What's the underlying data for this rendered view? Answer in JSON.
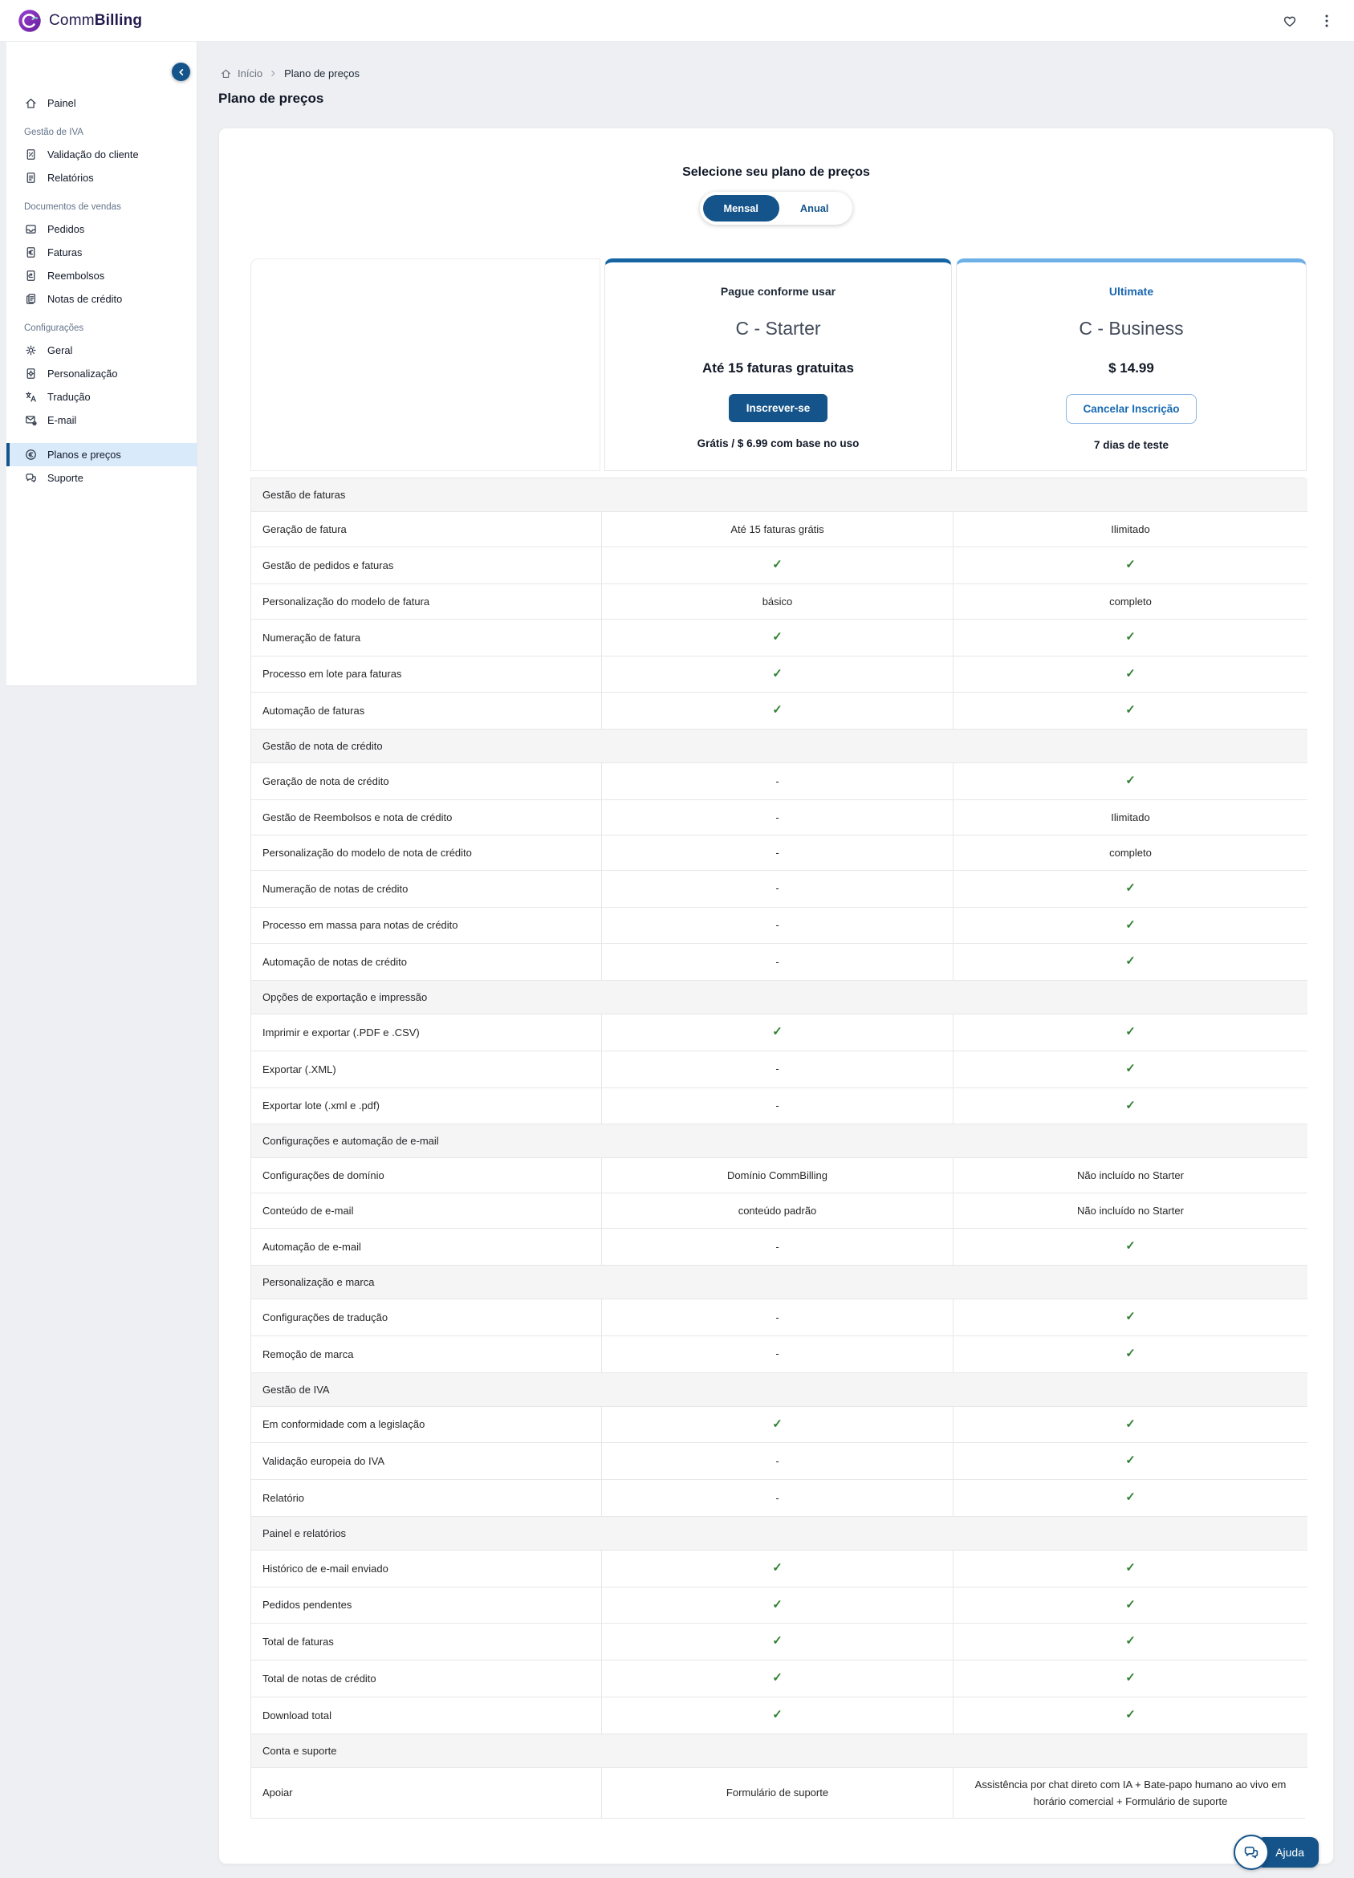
{
  "header": {
    "brand_prefix": "Comm",
    "brand_suffix": "Billing"
  },
  "breadcrumb": {
    "home": "Início",
    "current": "Plano de preços"
  },
  "page_title": "Plano de preços",
  "sidebar": {
    "groups": [
      {
        "label": null,
        "items": [
          {
            "icon": "home",
            "label": "Painel"
          }
        ]
      },
      {
        "label": "Gestão de IVA",
        "items": [
          {
            "icon": "receipt-percent",
            "label": "Validação do cliente"
          },
          {
            "icon": "doc",
            "label": "Relatórios"
          }
        ]
      },
      {
        "label": "Documentos de vendas",
        "items": [
          {
            "icon": "inbox",
            "label": "Pedidos"
          },
          {
            "icon": "receipt-euro",
            "label": "Faturas"
          },
          {
            "icon": "receipt-return",
            "label": "Reembolsos"
          },
          {
            "icon": "copy-doc",
            "label": "Notas de crédito"
          }
        ]
      },
      {
        "label": "Configurações",
        "items": [
          {
            "icon": "gear",
            "label": "Geral"
          },
          {
            "icon": "doc-gear",
            "label": "Personalização"
          },
          {
            "icon": "translate",
            "label": "Tradução"
          },
          {
            "icon": "mail-gear",
            "label": "E-mail"
          },
          {
            "icon": "euro-circle",
            "label": "Planos e preços",
            "active": true,
            "spaced": true
          },
          {
            "icon": "chat",
            "label": "Suporte"
          }
        ]
      }
    ]
  },
  "plan_selector": {
    "title": "Selecione seu plano de preços",
    "monthly": "Mensal",
    "annual": "Anual"
  },
  "plans": {
    "starter": {
      "badge": "Pague conforme usar",
      "name": "C - Starter",
      "subtitle": "Até 15 faturas gratuitas",
      "cta": "Inscrever-se",
      "note": "Grátis / $ 6.99 com base no uso"
    },
    "ultimate": {
      "badge": "Ultimate",
      "name": "C - Business",
      "price": "$ 14.99",
      "cta": "Cancelar Inscrição",
      "note": "7 dias de teste"
    }
  },
  "table": {
    "sections": [
      {
        "title": "Gestão de faturas",
        "rows": [
          {
            "feature": "Geração de fatura",
            "starter": "Até 15 faturas grátis",
            "ultimate": "Ilimitado"
          },
          {
            "feature": "Gestão de pedidos e faturas",
            "starter": "✓",
            "ultimate": "✓"
          },
          {
            "feature": "Personalização do modelo de fatura",
            "starter": "básico",
            "ultimate": "completo"
          },
          {
            "feature": "Numeração de fatura",
            "starter": "✓",
            "ultimate": "✓"
          },
          {
            "feature": "Processo em lote para faturas",
            "starter": "✓",
            "ultimate": "✓"
          },
          {
            "feature": "Automação de faturas",
            "starter": "✓",
            "ultimate": "✓"
          }
        ]
      },
      {
        "title": "Gestão de nota de crédito",
        "rows": [
          {
            "feature": "Geração de nota de crédito",
            "starter": "-",
            "ultimate": "✓"
          },
          {
            "feature": "Gestão de Reembolsos e nota de crédito",
            "starter": "-",
            "ultimate": "Ilimitado"
          },
          {
            "feature": "Personalização do modelo de nota de crédito",
            "starter": "-",
            "ultimate": "completo"
          },
          {
            "feature": "Numeração de notas de crédito",
            "starter": "-",
            "ultimate": "✓"
          },
          {
            "feature": "Processo em massa para notas de crédito",
            "starter": "-",
            "ultimate": "✓"
          },
          {
            "feature": "Automação de notas de crédito",
            "starter": "-",
            "ultimate": "✓"
          }
        ]
      },
      {
        "title": "Opções de exportação e impressão",
        "rows": [
          {
            "feature": "Imprimir e exportar (.PDF e .CSV)",
            "starter": "✓",
            "ultimate": "✓"
          },
          {
            "feature": "Exportar (.XML)",
            "starter": "-",
            "ultimate": "✓"
          },
          {
            "feature": "Exportar lote (.xml e .pdf)",
            "starter": "-",
            "ultimate": "✓"
          }
        ]
      },
      {
        "title": "Configurações e automação de e-mail",
        "rows": [
          {
            "feature": "Configurações de domínio",
            "starter": "Domínio CommBilling",
            "ultimate": "Não incluído no Starter"
          },
          {
            "feature": "Conteúdo de e-mail",
            "starter": "conteúdo padrão",
            "ultimate": "Não incluído no Starter"
          },
          {
            "feature": "Automação de e-mail",
            "starter": "-",
            "ultimate": "✓"
          }
        ]
      },
      {
        "title": "Personalização e marca",
        "rows": [
          {
            "feature": "Configurações de tradução",
            "starter": "-",
            "ultimate": "✓"
          },
          {
            "feature": "Remoção de marca",
            "starter": "-",
            "ultimate": "✓"
          }
        ]
      },
      {
        "title": "Gestão de IVA",
        "rows": [
          {
            "feature": "Em conformidade com a legislação",
            "starter": "✓",
            "ultimate": "✓"
          },
          {
            "feature": "Validação europeia do IVA",
            "starter": "-",
            "ultimate": "✓"
          },
          {
            "feature": "Relatório",
            "starter": "-",
            "ultimate": "✓"
          }
        ]
      },
      {
        "title": "Painel e relatórios",
        "rows": [
          {
            "feature": "Histórico de e-mail enviado",
            "starter": "✓",
            "ultimate": "✓"
          },
          {
            "feature": "Pedidos pendentes",
            "starter": "✓",
            "ultimate": "✓"
          },
          {
            "feature": "Total de faturas",
            "starter": "✓",
            "ultimate": "✓"
          },
          {
            "feature": "Total de notas de crédito",
            "starter": "✓",
            "ultimate": "✓"
          },
          {
            "feature": "Download total",
            "starter": "✓",
            "ultimate": "✓"
          }
        ]
      },
      {
        "title": "Conta e suporte",
        "rows": [
          {
            "feature": "Apoiar",
            "starter": "Formulário de suporte",
            "ultimate": "Assistência por chat direto com IA + Bate-papo humano ao vivo em horário comercial + Formulário de suporte"
          }
        ]
      }
    ]
  },
  "help": {
    "label": "Ajuda"
  },
  "colors": {
    "accent": "#15548a",
    "starter_border": "#1565a5",
    "ultimate_border": "#6fb1e7",
    "check_green": "#2f8132",
    "active_item_bg": "#d9eafb"
  }
}
